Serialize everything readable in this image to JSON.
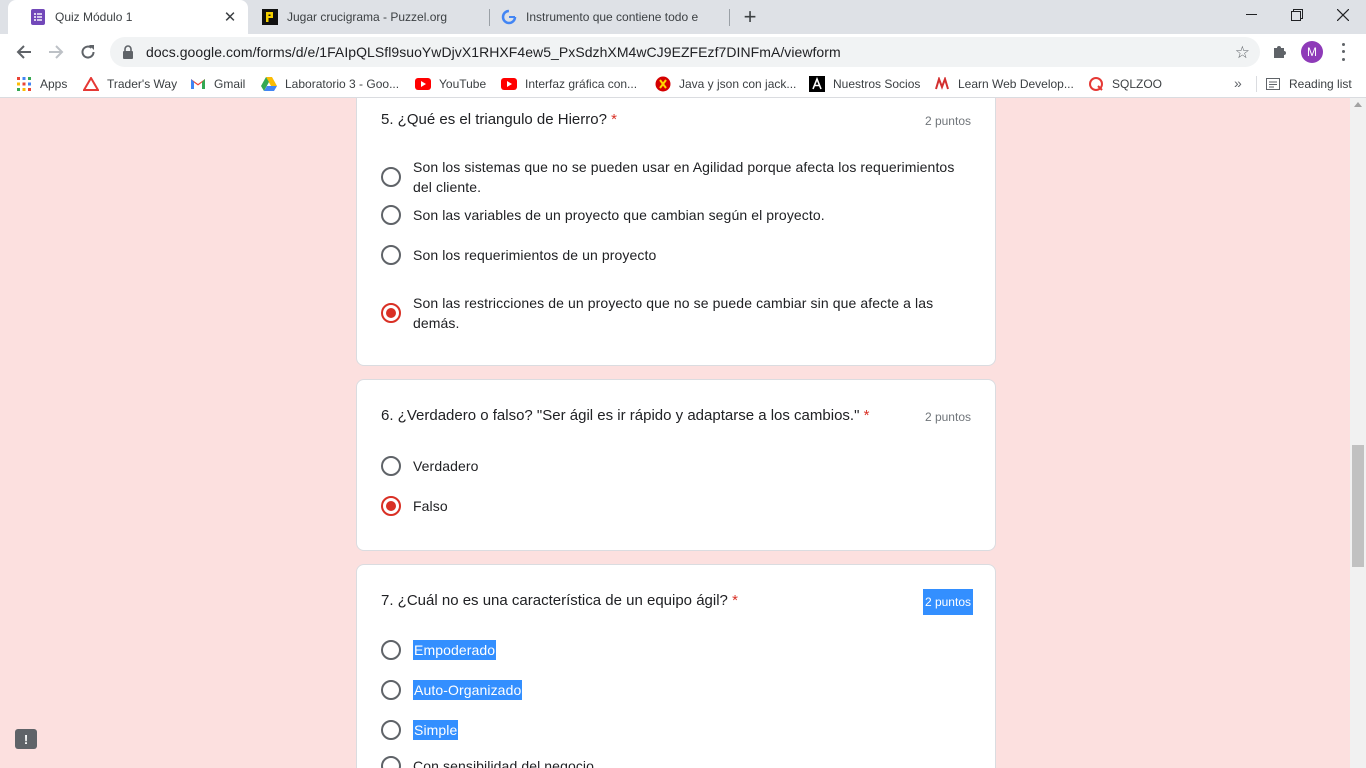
{
  "tabs": [
    {
      "title": "Quiz Módulo 1",
      "icon": "google-forms-icon"
    },
    {
      "title": "Jugar crucigrama - Puzzel.org",
      "icon": "puzzel-icon"
    },
    {
      "title": "Instrumento que contiene todo e",
      "icon": "google-icon"
    }
  ],
  "toolbar": {
    "url": "docs.google.com/forms/d/e/1FAIpQLSfl9suoYwDjvX1RHXF4ew5_PxSdzhXM4wCJ9EZFEzf7DINFmA/viewform",
    "profile_initial": "M"
  },
  "bookmarks": [
    {
      "label": "Apps",
      "icon": "apps-grid-icon"
    },
    {
      "label": "Trader's Way",
      "icon": "traders-way-icon"
    },
    {
      "label": "Gmail",
      "icon": "gmail-icon"
    },
    {
      "label": "Laboratorio 3 - Goo...",
      "icon": "google-drive-icon"
    },
    {
      "label": "YouTube",
      "icon": "youtube-icon"
    },
    {
      "label": "Interfaz gráfica con...",
      "icon": "youtube-icon"
    },
    {
      "label": "Java y json con jack...",
      "icon": "java-icon"
    },
    {
      "label": "Nuestros Socios",
      "icon": "a-letter-icon"
    },
    {
      "label": "Learn Web Develop...",
      "icon": "learn-web-icon"
    },
    {
      "label": "SQLZOO",
      "icon": "sqlzoo-icon"
    }
  ],
  "reading_list_label": "Reading list",
  "questions": [
    {
      "title": "5. ¿Qué es el triangulo de Hierro?",
      "required": "*",
      "points": "2 puntos",
      "options": [
        {
          "label": "Son los sistemas que no se pueden usar en Agilidad porque afecta los requerimientos del cliente.",
          "checked": false
        },
        {
          "label": "Son las variables de un proyecto que cambian según el proyecto.",
          "checked": false
        },
        {
          "label": "Son los requerimientos de un proyecto",
          "checked": false
        },
        {
          "label": "Son las restricciones de un proyecto que no se puede cambiar sin que afecte a las demás.",
          "checked": true
        }
      ]
    },
    {
      "title": "6. ¿Verdadero o falso? \"Ser ágil es ir rápido y adaptarse a los cambios.\"",
      "required": "*",
      "points": "2 puntos",
      "options": [
        {
          "label": "Verdadero",
          "checked": false
        },
        {
          "label": "Falso",
          "checked": true
        }
      ]
    },
    {
      "title": "7. ¿Cuál no es una característica de un equipo ágil?",
      "required": "*",
      "points": "2 puntos",
      "options": [
        {
          "label": "Empoderado",
          "checked": false
        },
        {
          "label": "Auto-Organizado",
          "checked": false
        },
        {
          "label": "Simple",
          "checked": false
        },
        {
          "label": "Con sensibilidad del negocio",
          "checked": false
        }
      ]
    }
  ],
  "colors": {
    "page_background": "#fce0df",
    "accent_red": "#d93025",
    "selection_blue": "#338fff"
  }
}
